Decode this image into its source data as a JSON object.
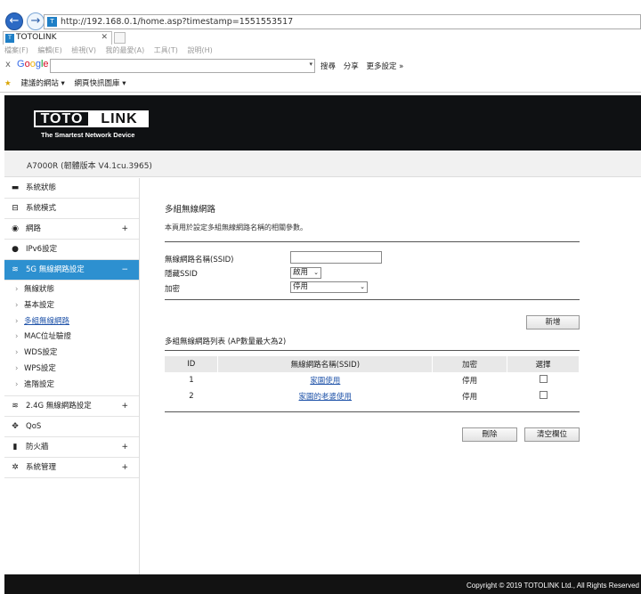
{
  "browser": {
    "address": "http://192.168.0.1/home.asp?timestamp=1551553517",
    "tab_title": "TOTOLINK",
    "menu": [
      "檔案(F)",
      "編輯(E)",
      "檢視(V)",
      "我的最愛(A)",
      "工具(T)",
      "說明(H)"
    ],
    "google_logo": "Google",
    "google_tools": [
      "搜尋",
      "分享",
      "更多設定 »"
    ],
    "favorites": [
      "建議的網站 ▾",
      "網頁快訊圖庫 ▾"
    ]
  },
  "header": {
    "logo_left": "TOTO",
    "logo_right": "LINK",
    "tagline": "The Smartest Network Device",
    "model": "A7000R (韌體版本 V4.1cu.3965)"
  },
  "sidebar": {
    "items": [
      {
        "label": "系統狀態",
        "icon": "▬"
      },
      {
        "label": "系統模式",
        "icon": "⊟"
      },
      {
        "label": "網路",
        "icon": "◉",
        "expand": "+"
      },
      {
        "label": "IPv6設定",
        "icon": "●"
      },
      {
        "label": "5G 無線網路設定",
        "icon": "≋",
        "expand": "−"
      },
      {
        "label": "2.4G 無線網路設定",
        "icon": "≋",
        "expand": "+"
      },
      {
        "label": "QoS",
        "icon": "✥"
      },
      {
        "label": "防火牆",
        "icon": "▮",
        "expand": "+"
      },
      {
        "label": "系統管理",
        "icon": "✲",
        "expand": "+"
      }
    ],
    "sub_items": [
      "無線狀態",
      "基本設定",
      "多組無線網路",
      "MAC位址驗證",
      "WDS設定",
      "WPS設定",
      "進階設定"
    ]
  },
  "main": {
    "title": "多組無線網路",
    "description": "本頁用於設定多組無線網路名稱的相關參數。",
    "ssid_label": "無線網路名稱(SSID)",
    "ssid_value": "",
    "hide_ssid_label": "隱藏SSID",
    "hide_ssid_value": "啟用",
    "encryption_label": "加密",
    "encryption_value": "停用",
    "add_button": "新增",
    "table_title": "多組無線網路列表 (AP數量最大為2)",
    "columns": [
      "ID",
      "無線網路名稱(SSID)",
      "加密",
      "選擇"
    ],
    "rows": [
      {
        "id": "1",
        "ssid": "家園使用",
        "encryption": "停用"
      },
      {
        "id": "2",
        "ssid": "家園的老婆使用",
        "encryption": "停用"
      }
    ],
    "delete_button": "刪除",
    "clear_button": "清空欄位"
  },
  "footer": {
    "copyright": "Copyright © 2019 TOTOLINK Ltd., All Rights Reserved"
  },
  "colors": {
    "accent": "#2d90d0",
    "header_bg": "#0f1113"
  }
}
